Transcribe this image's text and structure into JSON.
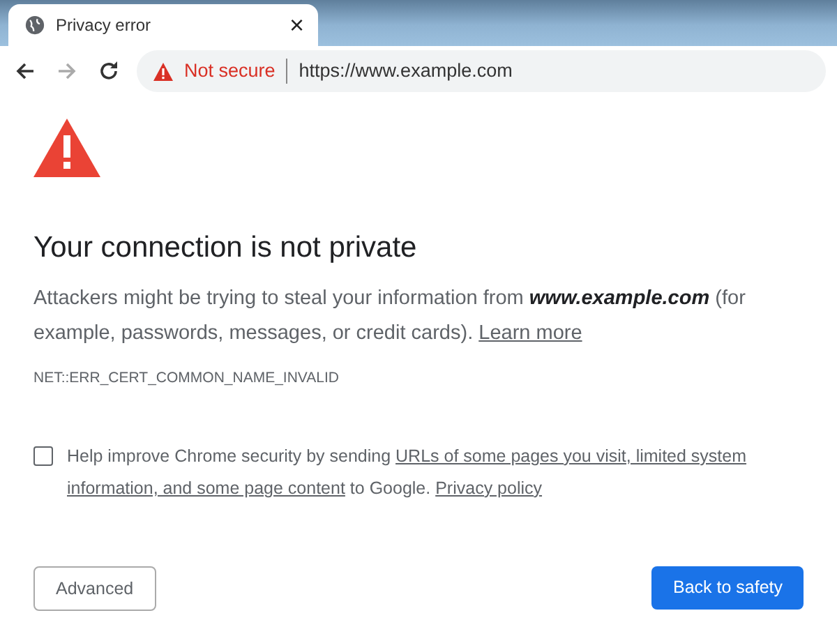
{
  "tab": {
    "title": "Privacy error",
    "close": "×"
  },
  "address_bar": {
    "security_label": "Not secure",
    "url": "https://www.example.com"
  },
  "toolbar": {
    "back_enabled": true,
    "forward_enabled": false
  },
  "heading": "Your connection is not private",
  "message": {
    "text": "Attackers might be trying to steal your information from **www.example.com** (for example, passwords, messages, or credit cards).",
    "link": "Learn more"
  },
  "error_code": "NET::ERR_CERT_COMMON_NAME_INVALID",
  "report": {
    "checked": false,
    "parts": [
      {
        "kind": "text",
        "text": "Help improve Chrome security by sending"
      },
      {
        "kind": "link",
        "text": "URLs of some pages you visit, limited system"
      },
      {
        "kind": "link",
        "text": "information, and some page content"
      },
      {
        "kind": "text",
        "text": "to Google."
      },
      {
        "kind": "link",
        "text": "Privacy policy"
      }
    ]
  },
  "buttons": [
    {
      "label": "Advanced",
      "kind": "secondary"
    },
    {
      "label": "Back to safety",
      "kind": "primary"
    }
  ]
}
